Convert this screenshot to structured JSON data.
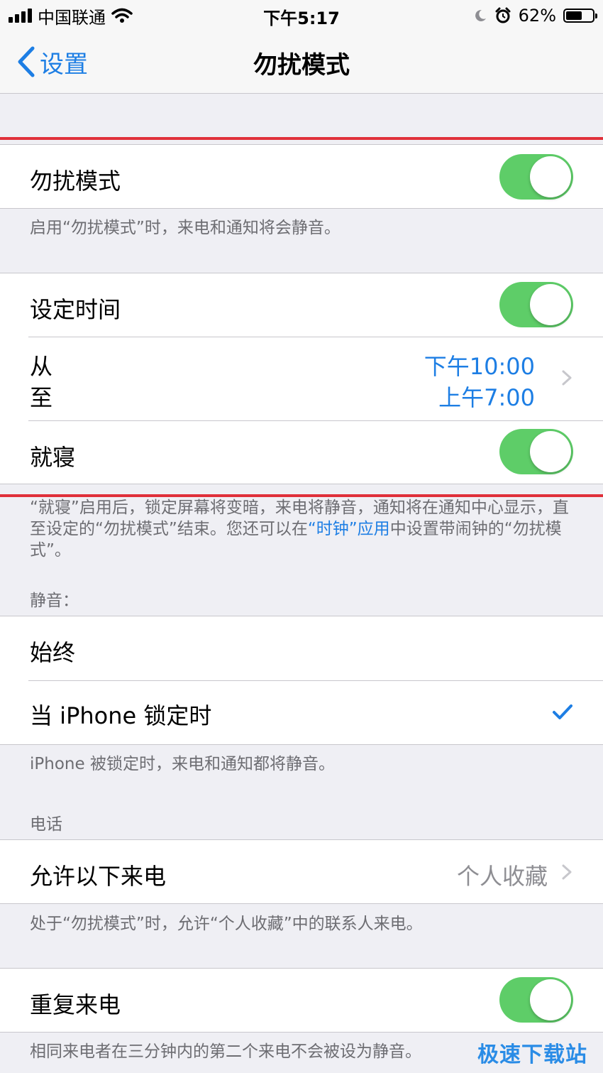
{
  "status_bar": {
    "carrier": "中国联通",
    "time": "下午5:17",
    "battery_percent": "62%",
    "battery_level": 0.62
  },
  "nav": {
    "back_label": "设置",
    "title": "勿扰模式"
  },
  "dnd": {
    "label": "勿扰模式",
    "enabled": true,
    "footer": "启用“勿扰模式”时，来电和通知将会静音。"
  },
  "schedule": {
    "label": "设定时间",
    "enabled": true,
    "from_label": "从",
    "to_label": "至",
    "from_value": "下午10:00",
    "to_value": "上午7:00",
    "bedtime_label": "就寝",
    "bedtime_enabled": true,
    "bedtime_footer_part1": "“就寝”启用后，锁定屏幕将变暗，来电将静音，通知将在通知中心显示，直至设定的“勿扰模式”结束。您还可以在",
    "bedtime_footer_link": "“时钟”应用",
    "bedtime_footer_part2": "中设置带闹钟的“勿扰模式”。"
  },
  "silence": {
    "header": "静音：",
    "always_label": "始终",
    "locked_label": "当 iPhone 锁定时",
    "locked_selected": true,
    "footer": "iPhone 被锁定时，来电和通知都将静音。"
  },
  "phone": {
    "header": "电话",
    "allow_label": "允许以下来电",
    "allow_value": "个人收藏",
    "allow_footer": "处于“勿扰模式”时，允许“个人收藏”中的联系人来电。",
    "repeat_label": "重复来电",
    "repeat_enabled": true,
    "repeat_footer": "相同来电者在三分钟内的第二个来电不会被设为静音。"
  },
  "watermark": "极速下载站",
  "colors": {
    "accent": "#1d7ee4",
    "toggle_on": "#5ecd68",
    "highlight_line": "#e0303a",
    "background": "#efeff4"
  }
}
